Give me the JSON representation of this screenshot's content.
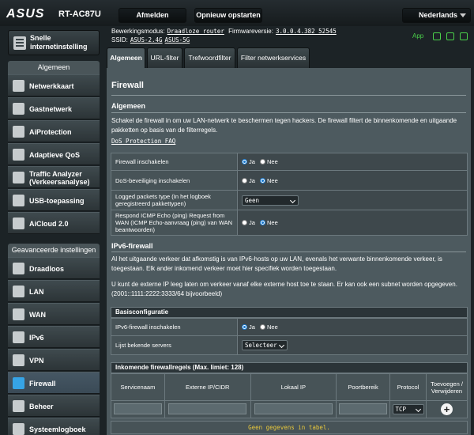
{
  "header": {
    "brand": "ASUS",
    "model": "RT-AC87U",
    "logout_label": "Afmelden",
    "reboot_label": "Opnieuw opstarten",
    "language": "Nederlands"
  },
  "status": {
    "op_mode_label": "Bewerkingsmodus:",
    "op_mode_value": "Draadloze router",
    "firmware_label": "Firmwareversie:",
    "firmware_value": "3.0.0.4.382_52545",
    "ssid_label": "SSID:",
    "ssid_1": "ASUS-2.4G",
    "ssid_2": "ASUS-5G",
    "app_label": "App"
  },
  "sidebar": {
    "quick_setup": "Snelle internetinstelling",
    "general_heading": "Algemeen",
    "general_items": [
      "Netwerkkaart",
      "Gastnetwerk",
      "AiProtection",
      "Adaptieve QoS",
      "Traffic Analyzer (Verkeersanalyse)",
      "USB-toepassing",
      "AiCloud 2.0"
    ],
    "advanced_heading": "Geavanceerde instellingen",
    "advanced_items": [
      "Draadloos",
      "LAN",
      "WAN",
      "IPv6",
      "VPN",
      "Firewall",
      "Beheer",
      "Systeemlogboek"
    ]
  },
  "tabs": [
    "Algemeen",
    "URL-filter",
    "Trefwoordfilter",
    "Filter netwerkservices"
  ],
  "main": {
    "title": "Firewall",
    "general_heading": "Algemeen",
    "desc": "Schakel de firewall in om uw LAN-netwerk te beschermen tegen hackers. De firewall filtert de binnenkomende en uitgaande pakketten op basis van de filterregels.",
    "faq_link": "DoS Protection FAQ",
    "rows": [
      {
        "label": "Firewall inschakelen",
        "yes": "Ja",
        "no": "Nee"
      },
      {
        "label": "DoS-beveiliging inschakelen",
        "yes": "Ja",
        "no": "Nee"
      },
      {
        "label": "Logged packets type (In het logboek geregistreerd pakkettypen)",
        "value": "Geen"
      },
      {
        "label": "Respond ICMP Echo (ping) Request from WAN (ICMP Echo-aanvraag (ping) van WAN beantwoorden)",
        "yes": "Ja",
        "no": "Nee"
      }
    ],
    "ipv6_heading": "IPv6-firewall",
    "ipv6_desc1": "Al het uitgaande verkeer dat afkomstig is van IPv6-hosts op uw LAN, evenals het verwante binnenkomende verkeer, is toegestaan. Elk ander inkomend verkeer moet hier specifiek worden toegestaan.",
    "ipv6_desc2": "U kunt de externe IP leeg laten om verkeer vanaf elke externe host toe te staan. Er kan ook een subnet worden opgegeven. (2001::1111:2222:3333/64 bijvoorbeeld)",
    "basic_config": "Basisconfiguratie",
    "ipv6_rows": [
      {
        "label": "IPv6-firewall inschakelen",
        "yes": "Ja",
        "no": "Nee"
      },
      {
        "label": "Lijst bekende servers",
        "value": "Selecteer"
      }
    ],
    "rules_heading": "Inkomende firewallregels (Max. limiet: 128)",
    "rules_columns": [
      "Servicenaam",
      "Externe IP/CIDR",
      "Lokaal IP",
      "Poortbereik",
      "Protocol",
      "Toevoegen / Verwijderen"
    ],
    "protocol_value": "TCP",
    "add_symbol": "+",
    "empty_text": "Geen gegevens in tabel."
  }
}
